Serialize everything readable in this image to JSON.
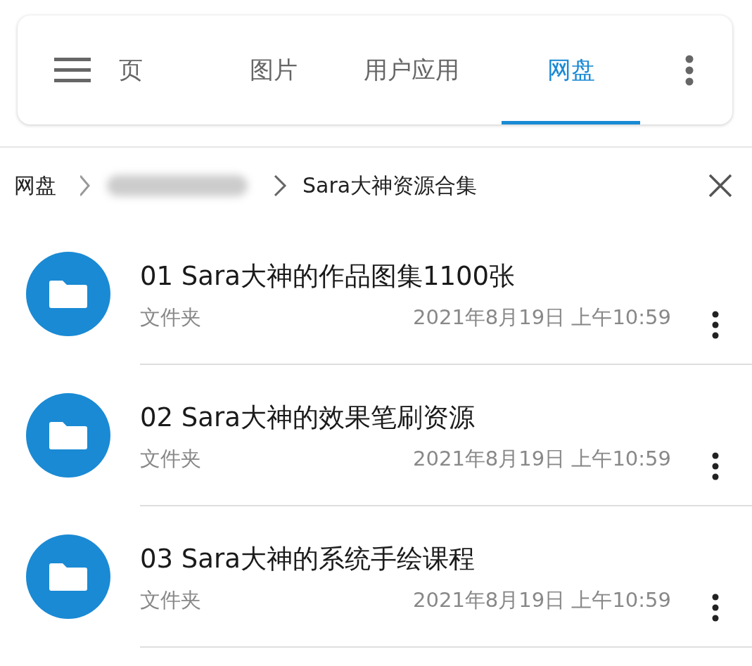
{
  "tabs": [
    {
      "label": "页",
      "selected": false
    },
    {
      "label": "图片",
      "selected": false
    },
    {
      "label": "用户应用",
      "selected": false
    },
    {
      "label": "网盘",
      "selected": true
    }
  ],
  "breadcrumb": {
    "root": "网盘",
    "current": "Sara大神资源合集"
  },
  "files": [
    {
      "name": "01 Sara大神的作品图集1100张",
      "type": "文件夹",
      "date": "2021年8月19日 上午10:59"
    },
    {
      "name": "02 Sara大神的效果笔刷资源",
      "type": "文件夹",
      "date": "2021年8月19日 上午10:59"
    },
    {
      "name": "03 Sara大神的系统手绘课程",
      "type": "文件夹",
      "date": "2021年8月19日 上午10:59"
    }
  ]
}
